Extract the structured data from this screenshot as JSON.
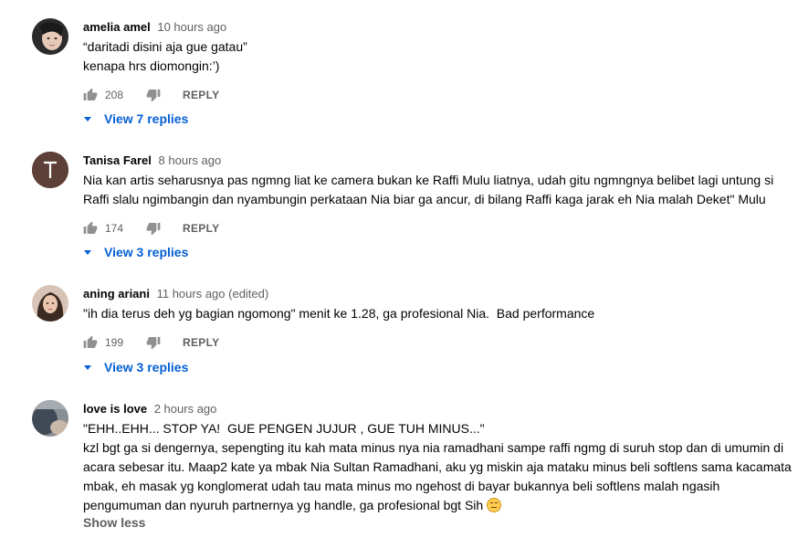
{
  "comments": [
    {
      "author": "amelia amel",
      "time": "10 hours ago",
      "text": "“daritadi disini aja gue gatau”\nkenapa hrs diomongin:’)",
      "likes": "208",
      "reply_label": "REPLY",
      "view_replies": "View 7 replies",
      "avatar": {
        "kind": "photo",
        "colors": [
          "#2b2b2b",
          "#e7c9b8"
        ]
      }
    },
    {
      "author": "Tanisa Farel",
      "time": "8 hours ago",
      "text": "Nia kan artis seharusnya pas ngmng liat ke camera bukan ke Raffi Mulu liatnya, udah gitu ngmngnya belibet lagi untung si Raffi slalu ngimbangin dan nyambungin perkataan Nia biar ga ancur, di bilang Raffi kaga jarak eh Nia malah Deket\" Mulu",
      "likes": "174",
      "reply_label": "REPLY",
      "view_replies": "View 3 replies",
      "avatar": {
        "kind": "letter",
        "letter": "T",
        "color": "#5d4037"
      }
    },
    {
      "author": "aning ariani",
      "time": "11 hours ago (edited)",
      "text": "\"ih dia terus deh yg bagian ngomong\" menit ke 1.28, ga profesional Nia.  Bad performance",
      "likes": "199",
      "reply_label": "REPLY",
      "view_replies": "View 3 replies",
      "avatar": {
        "kind": "photo",
        "colors": [
          "#d8c4b6",
          "#3b2a22"
        ]
      }
    },
    {
      "author": "love is love",
      "time": "2 hours ago",
      "text": "\"EHH..EHH... STOP YA!  GUE PENGEN JUJUR , GUE TUH MINUS...\"\nkzl bgt ga si dengernya, sepengting itu kah mata minus nya nia ramadhani sampe raffi ngmg di suruh stop dan di umumin di acara sebesar itu. Maap2 kate ya mbak Nia Sultan Ramadhani, aku yg miskin aja mataku minus beli softlens sama kacamata mbak, eh masak yg konglomerat udah tau mata minus mo ngehost di bayar bukannya beli softlens malah ngasih pengumuman dan nyuruh partnernya yg handle, ga profesional bgt Sih",
      "emoji": "expressionless-face",
      "show_less": "Show less",
      "avatar": {
        "kind": "photo",
        "colors": [
          "#8a8f96",
          "#3f4a56"
        ]
      }
    }
  ],
  "icons": {
    "like": "thumbs-up-icon",
    "dislike": "thumbs-down-icon",
    "expand": "caret-down-icon"
  },
  "colors": {
    "link_blue": "#065fd4",
    "meta_gray": "#606060",
    "text": "#030303"
  }
}
